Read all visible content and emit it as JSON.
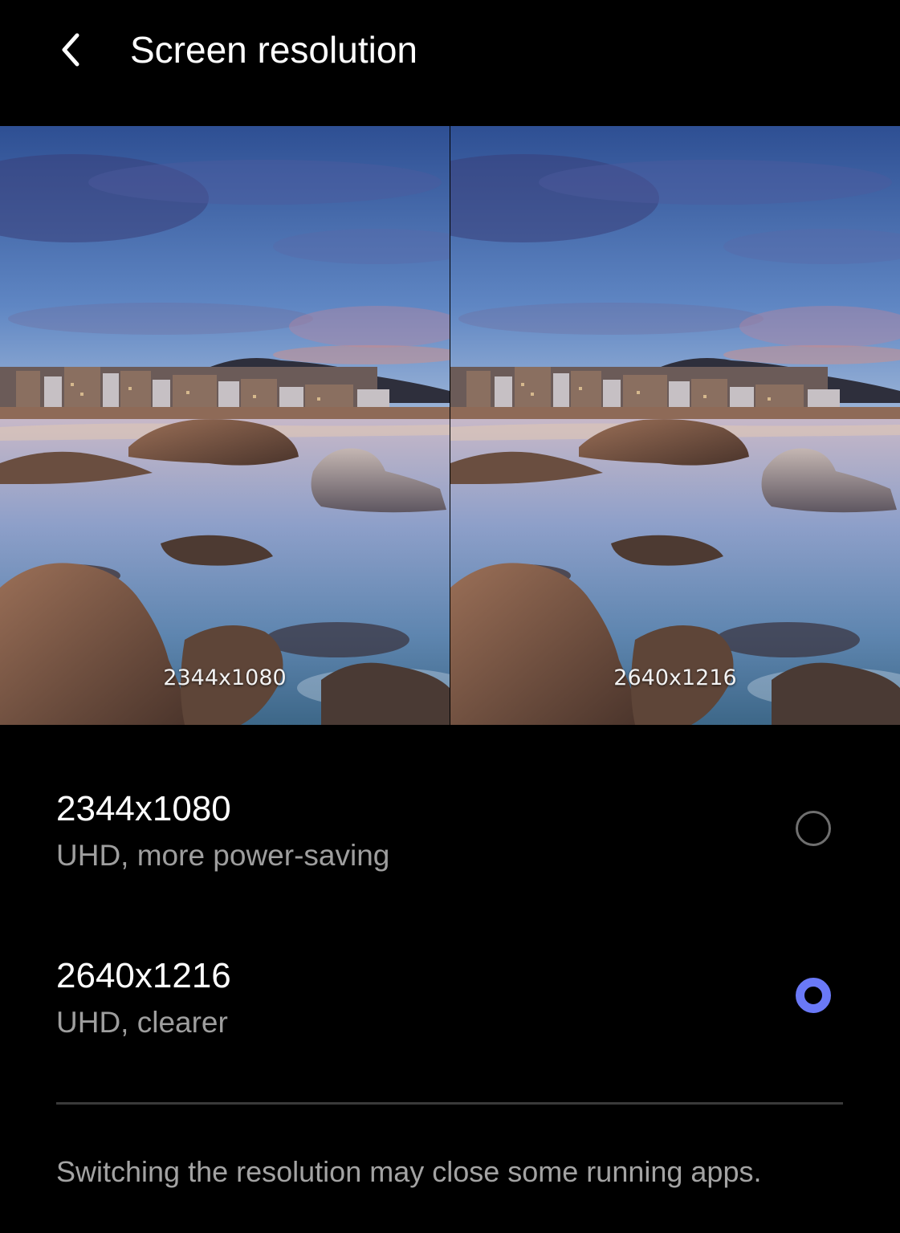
{
  "header": {
    "back_icon": "chevron-left-icon",
    "title": "Screen resolution"
  },
  "previews": [
    {
      "label": "2344x1080"
    },
    {
      "label": "2640x1216"
    }
  ],
  "options": [
    {
      "title": "2344x1080",
      "subtitle": "UHD, more power-saving",
      "selected": false
    },
    {
      "title": "2640x1216",
      "subtitle": "UHD, clearer",
      "selected": true
    }
  ],
  "footnote": "Switching the resolution may close some running apps.",
  "colors": {
    "background": "#000000",
    "accent": "#6a79f7",
    "secondary_text": "#9e9e9e"
  }
}
